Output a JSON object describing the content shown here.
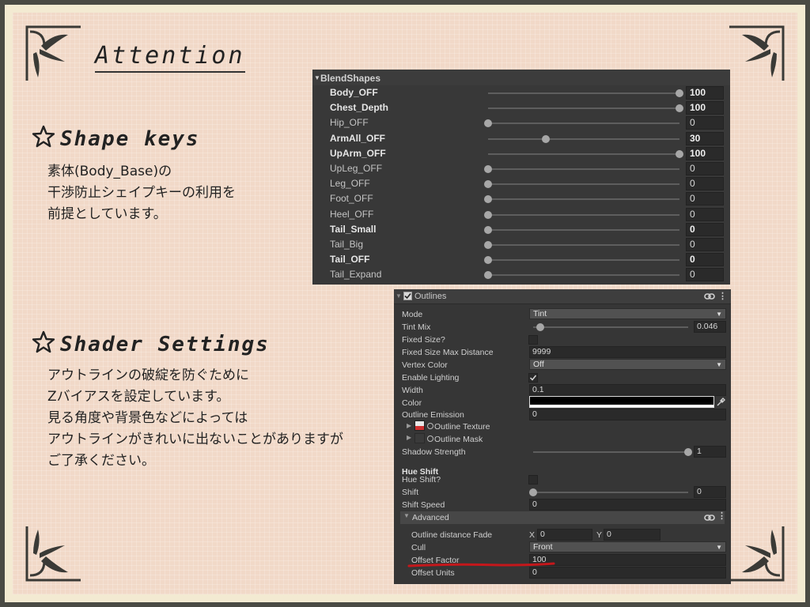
{
  "page": {
    "title": "Attention",
    "section1": {
      "heading": "Shape keys",
      "text_lines": [
        "素体(Body_Base)の",
        "干渉防止シェイプキーの利用を",
        "前提としています。"
      ]
    },
    "section2": {
      "heading": "Shader Settings",
      "text_lines": [
        "アウトラインの破綻を防ぐために",
        "Zバイアスを設定しています。",
        "見る角度や背景色などによっては",
        "アウトラインがきれいに出ないことがありますが",
        "ご了承ください。"
      ]
    }
  },
  "blendshapes": {
    "header": "BlendShapes",
    "rows": [
      {
        "label": "Body_OFF",
        "value": 100,
        "display": "100",
        "bold": true
      },
      {
        "label": "Chest_Depth",
        "value": 100,
        "display": "100",
        "bold": true
      },
      {
        "label": "Hip_OFF",
        "value": 0,
        "display": "0",
        "bold": false
      },
      {
        "label": "ArmAll_OFF",
        "value": 30,
        "display": "30",
        "bold": true
      },
      {
        "label": "UpArm_OFF",
        "value": 100,
        "display": "100",
        "bold": true
      },
      {
        "label": "UpLeg_OFF",
        "value": 0,
        "display": "0",
        "bold": false
      },
      {
        "label": "Leg_OFF",
        "value": 0,
        "display": "0",
        "bold": false
      },
      {
        "label": "Foot_OFF",
        "value": 0,
        "display": "0",
        "bold": false
      },
      {
        "label": "Heel_OFF",
        "value": 0,
        "display": "0",
        "bold": false
      },
      {
        "label": "Tail_Small",
        "value": 0,
        "display": "0",
        "bold": true
      },
      {
        "label": "Tail_Big",
        "value": 0,
        "display": "0",
        "bold": false
      },
      {
        "label": "Tail_OFF",
        "value": 0,
        "display": "0",
        "bold": true
      },
      {
        "label": "Tail_Expand",
        "value": 0,
        "display": "0",
        "bold": false
      }
    ]
  },
  "outlines": {
    "header": "Outlines",
    "mode_label": "Mode",
    "mode_value": "Tint",
    "tint_mix_label": "Tint Mix",
    "tint_mix_value": "0.046",
    "tint_mix_fraction": 0.046,
    "fixed_size_label": "Fixed Size?",
    "fixed_size_max_label": "Fixed Size Max Distance",
    "fixed_size_max_value": "9999",
    "vertex_color_label": "Vertex Color",
    "vertex_color_value": "Off",
    "enable_lighting_label": "Enable Lighting",
    "width_label": "Width",
    "width_value": "0.1",
    "color_label": "Color",
    "emission_label": "Outline Emission",
    "emission_value": "0",
    "texture_label": "Outline Texture",
    "mask_label": "Outline Mask",
    "shadow_strength_label": "Shadow Strength",
    "shadow_strength_value": "1",
    "shadow_strength_fraction": 1,
    "hue_shift_title": "Hue Shift",
    "hue_shift_toggle_label": "Hue Shift?",
    "shift_label": "Shift",
    "shift_value": "0",
    "shift_fraction": 0,
    "shift_speed_label": "Shift Speed",
    "shift_speed_value": "0",
    "advanced_label": "Advanced",
    "distance_fade_label": "Outline distance Fade",
    "fade_x_label": "X",
    "fade_x_value": "0",
    "fade_y_label": "Y",
    "fade_y_value": "0",
    "cull_label": "Cull",
    "cull_value": "Front",
    "offset_factor_label": "Offset Factor",
    "offset_factor_value": "100",
    "offset_units_label": "Offset Units",
    "offset_units_value": "0"
  },
  "colors": {
    "underline_red": "#c4171b",
    "outline_color": "#000000"
  }
}
